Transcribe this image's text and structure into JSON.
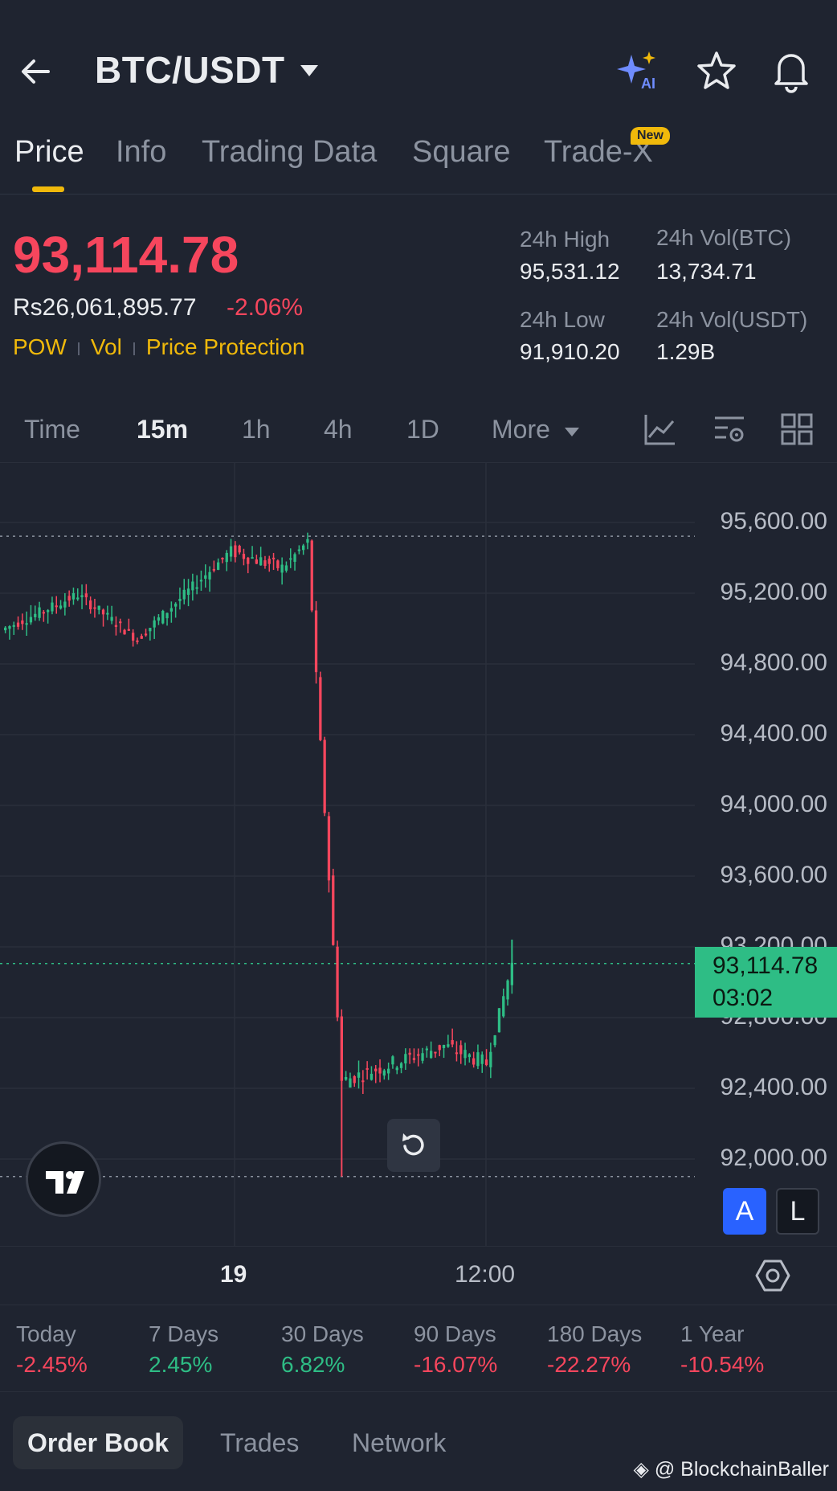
{
  "header": {
    "pair": "BTC/USDT",
    "icons": [
      "back-arrow-icon",
      "chevron-down-icon",
      "ai-sparkle-icon",
      "star-icon",
      "bell-icon"
    ]
  },
  "tabs": {
    "items": [
      "Price",
      "Info",
      "Trading Data",
      "Square",
      "Trade-X"
    ],
    "active": "Price",
    "new_badge": "New"
  },
  "ticker": {
    "last_price": "93,114.78",
    "fiat_price": "Rs26,061,895.77",
    "change_pct": "-2.06%",
    "tags": [
      "POW",
      "Vol",
      "Price Protection"
    ],
    "stats": {
      "high_label": "24h High",
      "high_value": "95,531.12",
      "vol_btc_label": "24h Vol(BTC)",
      "vol_btc_value": "13,734.71",
      "low_label": "24h Low",
      "low_value": "91,910.20",
      "vol_usdt_label": "24h Vol(USDT)",
      "vol_usdt_value": "1.29B"
    }
  },
  "timeframes": {
    "items": [
      "Time",
      "15m",
      "1h",
      "4h",
      "1D",
      "More"
    ],
    "active": "15m",
    "tool_icons": [
      "line-chart-icon",
      "indicator-settings-icon",
      "grid-layout-icon"
    ]
  },
  "chart": {
    "y_labels": [
      "95,600.00",
      "95,200.00",
      "94,800.00",
      "94,400.00",
      "94,000.00",
      "93,600.00",
      "93,200.00",
      "92,800.00",
      "92,400.00",
      "92,000.00"
    ],
    "last_price_label": "93,114.78",
    "countdown": "03:02",
    "x_labels": [
      "19",
      "12:00"
    ],
    "scale_buttons": {
      "auto": "A",
      "log": "L"
    },
    "colors": {
      "up": "#2ebd85",
      "down": "#f6465d",
      "background": "#1f2430",
      "grid": "#2a2f3b"
    }
  },
  "chart_data": {
    "type": "candlestick",
    "interval": "15m",
    "ylim": [
      91900,
      95700
    ],
    "high_line": 95531.12,
    "low_line": 91910.2,
    "last": 93114.78,
    "segments": [
      {
        "from": 95000,
        "to": 95200,
        "count": 18,
        "trend": "up"
      },
      {
        "from": 95200,
        "to": 94950,
        "count": 14,
        "trend": "down"
      },
      {
        "from": 94950,
        "to": 95450,
        "count": 22,
        "trend": "up"
      },
      {
        "from": 95450,
        "to": 95350,
        "count": 12,
        "trend": "flat"
      },
      {
        "from": 95350,
        "to": 95500,
        "count": 6,
        "trend": "up"
      },
      {
        "from": 95500,
        "to": 92450,
        "count": 8,
        "trend": "down"
      },
      {
        "from": 92450,
        "to": 92650,
        "count": 24,
        "trend": "flat"
      },
      {
        "from": 92650,
        "to": 92550,
        "count": 10,
        "trend": "flat"
      },
      {
        "from": 92550,
        "to": 93114.78,
        "count": 6,
        "trend": "up"
      }
    ]
  },
  "performance": [
    {
      "label": "Today",
      "value": "-2.45%",
      "dir": "neg"
    },
    {
      "label": "7 Days",
      "value": "2.45%",
      "dir": "pos"
    },
    {
      "label": "30 Days",
      "value": "6.82%",
      "dir": "pos"
    },
    {
      "label": "90 Days",
      "value": "-16.07%",
      "dir": "neg"
    },
    {
      "label": "180 Days",
      "value": "-22.27%",
      "dir": "neg"
    },
    {
      "label": "1 Year",
      "value": "-10.54%",
      "dir": "neg"
    }
  ],
  "bottom_tabs": {
    "items": [
      "Order Book",
      "Trades",
      "Network"
    ],
    "active": "Order Book"
  },
  "watermark": "@ BlockchainBaller"
}
